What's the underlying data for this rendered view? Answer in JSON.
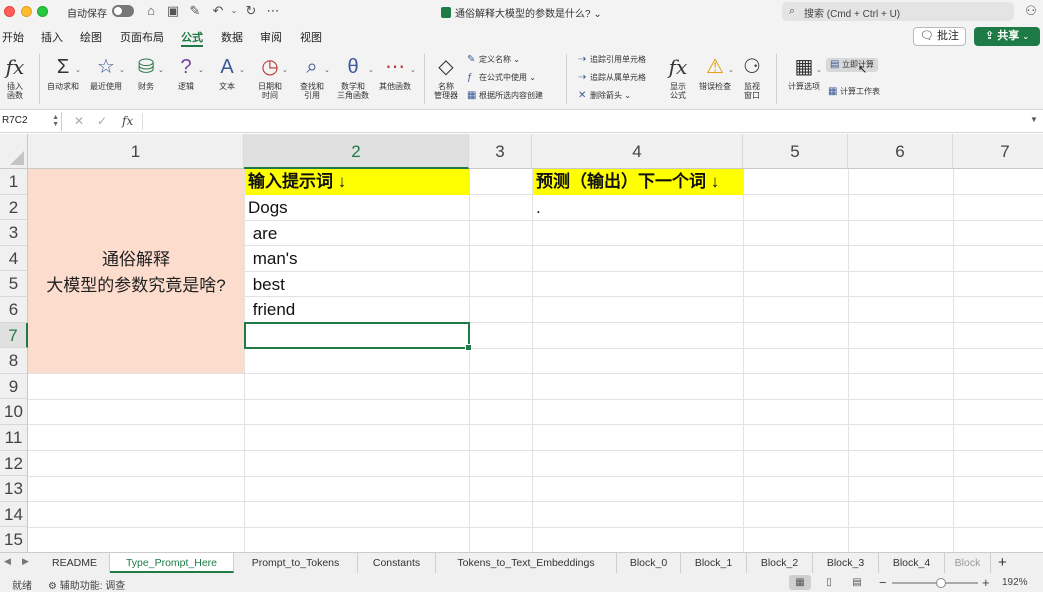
{
  "titlebar": {
    "autosave_label": "自动保存",
    "doc_title": "通俗解释大模型的参数是什么? ⌄",
    "search_placeholder": "搜索 (Cmd + Ctrl + U)"
  },
  "menu": {
    "tabs": [
      "开始",
      "插入",
      "绘图",
      "页面布局",
      "公式",
      "数据",
      "审阅",
      "视图"
    ],
    "active_tab": "公式",
    "comment_label": "批注",
    "share_label": "共享"
  },
  "ribbon": {
    "insert_function": "插入\n函数",
    "autosum": "自动求和",
    "recent": "最近使用",
    "financial": "财务",
    "logical": "逻辑",
    "text": "文本",
    "datetime": "日期和\n时间",
    "lookup": "查找和\n引用",
    "math": "数学和\n三角函数",
    "other": "其他函数",
    "name_manager": "名称\n管理器",
    "define_name": "定义名称",
    "use_in_formula": "在公式中使用",
    "create_from_selection": "根据所选内容创建",
    "trace_precedents": "追踪引用单元格",
    "trace_dependents": "追踪从属单元格",
    "remove_arrows": "删除箭头",
    "show_formulas": "显示\n公式",
    "error_checking": "错误检查",
    "watch_window": "监视\n窗口",
    "calc_options": "计算选项",
    "calc_now": "立即计算",
    "calc_sheet": "计算工作表"
  },
  "formula_bar": {
    "name_box": "R7C2",
    "fx_label": "fx",
    "value": ""
  },
  "grid": {
    "columns": [
      "1",
      "2",
      "3",
      "4",
      "5",
      "6",
      "7"
    ],
    "rows": [
      "1",
      "2",
      "3",
      "4",
      "5",
      "6",
      "7",
      "8",
      "9",
      "10",
      "11",
      "12",
      "13",
      "14",
      "15"
    ],
    "selected_row": "7",
    "selected_col": "2",
    "merged_note_line1": "通俗解释",
    "merged_note_line2": "大模型的参数究竟是啥?",
    "col2_header": "输入提示词 ↓",
    "col2_values": [
      "Dogs",
      " are",
      " man's",
      " best",
      " friend"
    ],
    "col4_header": "预测（输出）下一个词 ↓",
    "col4_values": [
      "."
    ]
  },
  "sheets": {
    "tabs": [
      "README",
      "Type_Prompt_Here",
      "Prompt_to_Tokens",
      "Constants",
      "Tokens_to_Text_Embeddings",
      "Block_0",
      "Block_1",
      "Block_2",
      "Block_3",
      "Block_4",
      "Block"
    ],
    "active": "Type_Prompt_Here",
    "add_label": "+"
  },
  "status": {
    "ready": "就绪",
    "accessibility": "辅助功能: 调查",
    "zoom": "192%"
  },
  "colors": {
    "accent": "#1e7b45",
    "header_fill": "#ffff00",
    "merged_fill": "#fcdccd"
  }
}
